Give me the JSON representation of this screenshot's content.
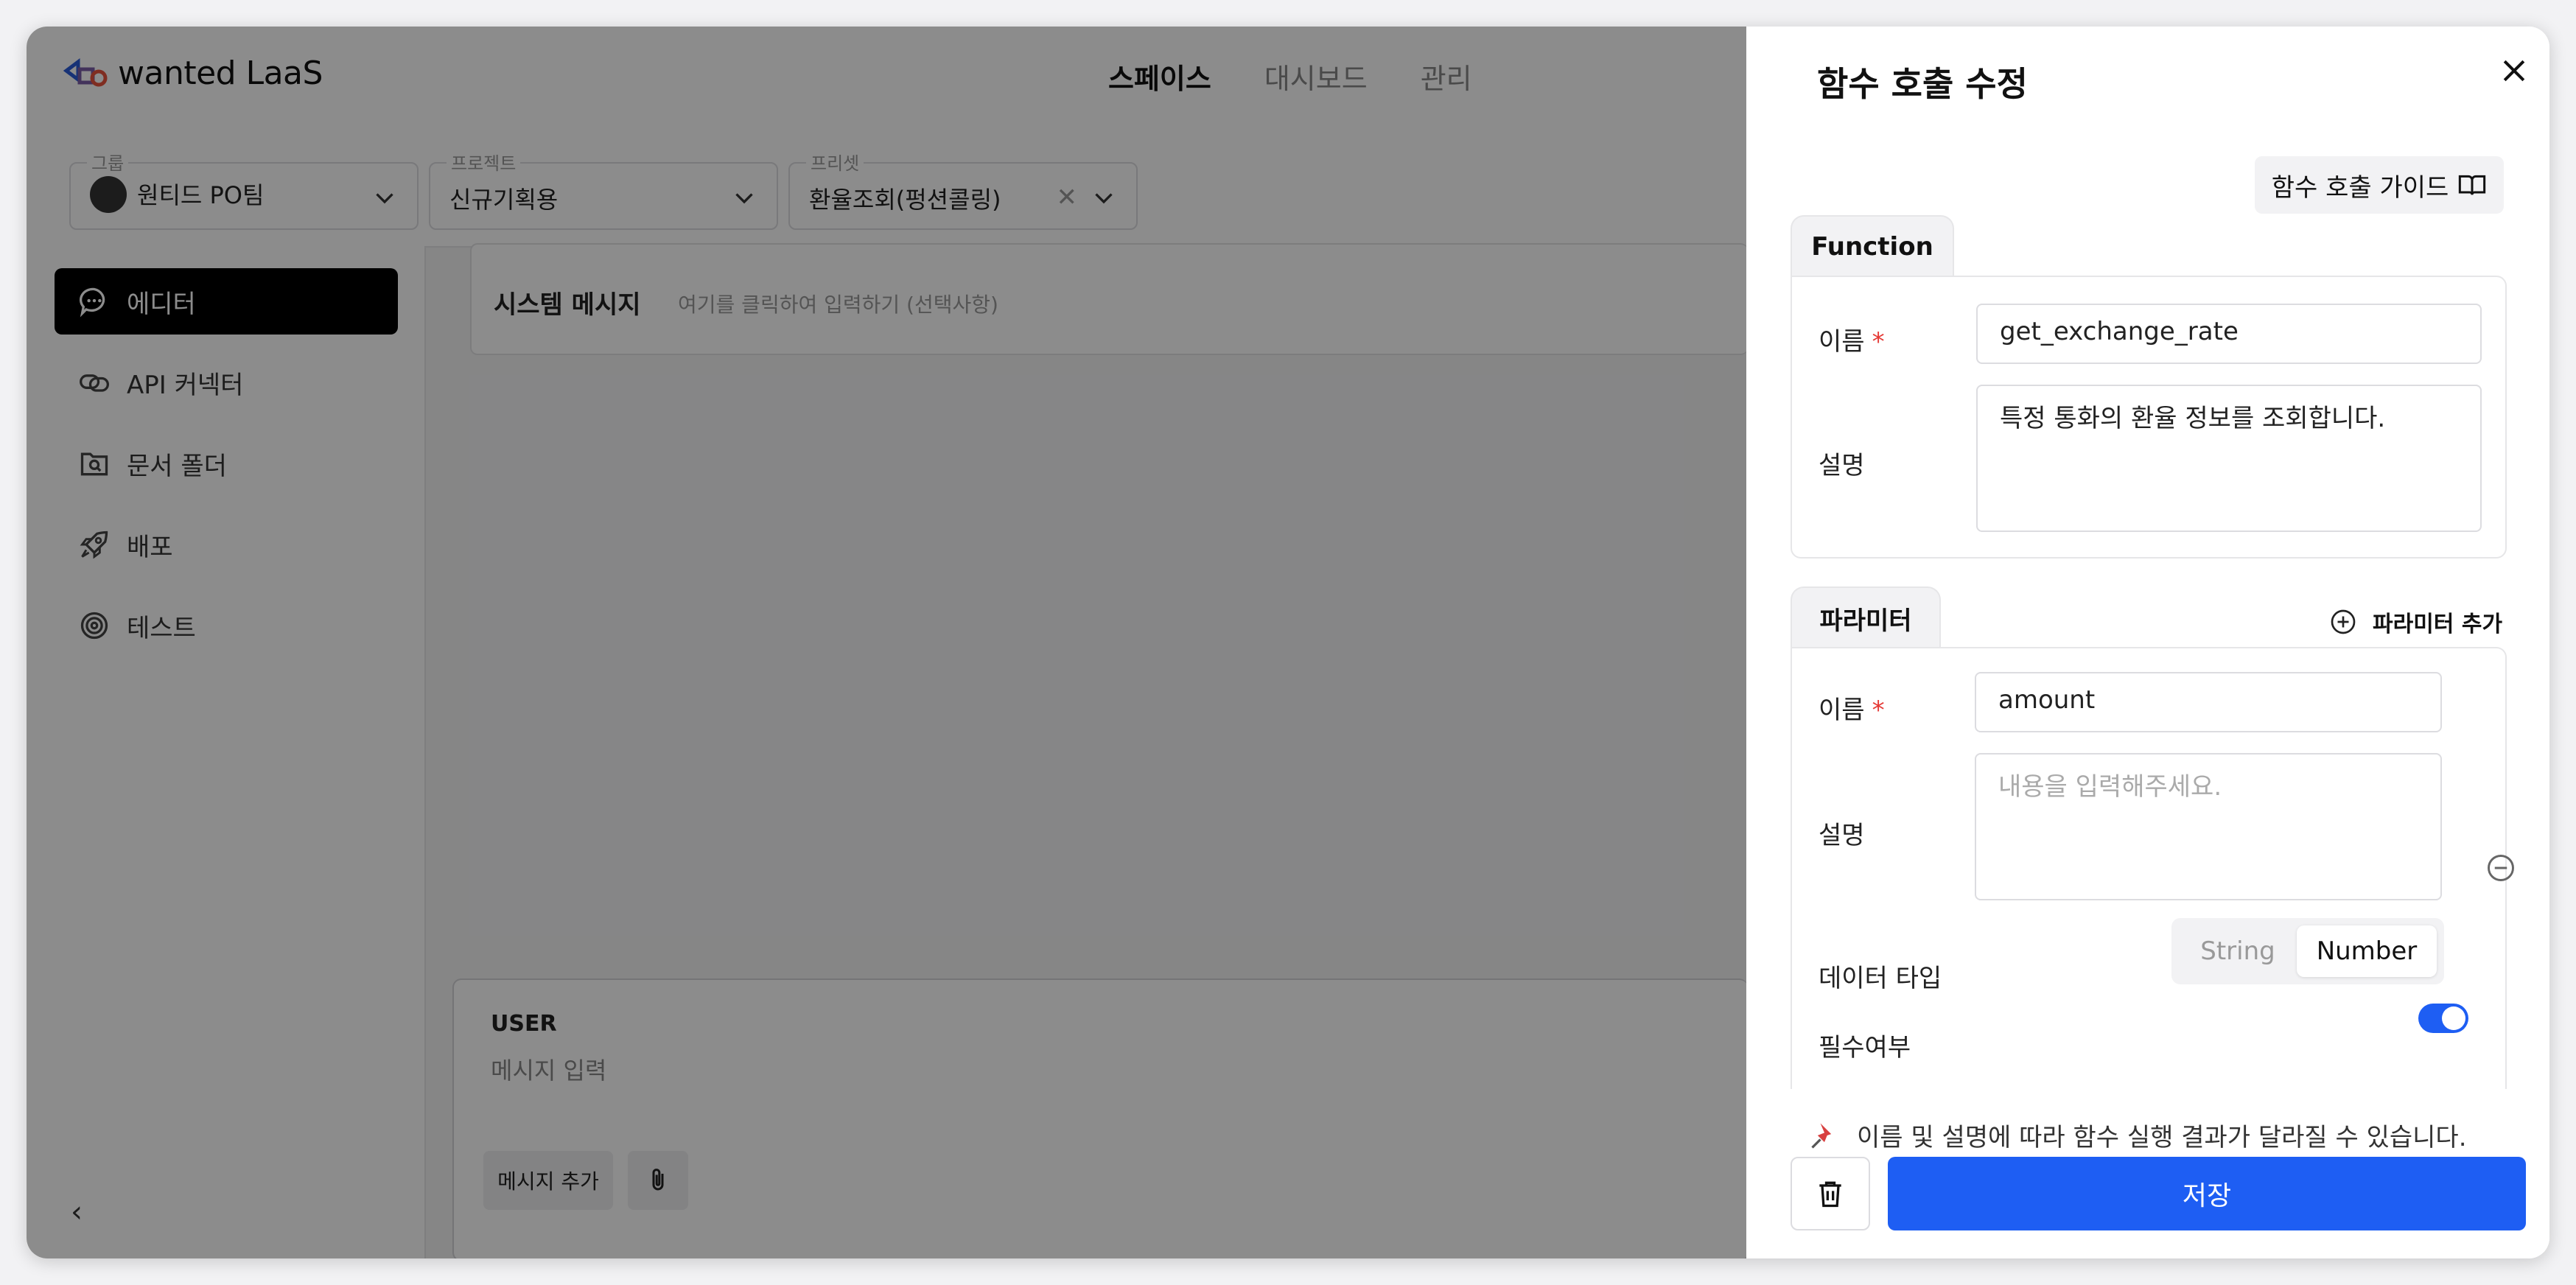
{
  "app": {
    "logo_text": "wanted LaaS",
    "nav": [
      "스페이스",
      "대시보드",
      "관리"
    ],
    "filters": {
      "group": {
        "label": "그룹",
        "value": "원티드 PO팀"
      },
      "project": {
        "label": "프로젝트",
        "value": "신규기획용"
      },
      "preset": {
        "label": "프리셋",
        "value": "환율조회(펑션콜링)"
      }
    },
    "sidebar": [
      {
        "label": "에디터",
        "icon": "chat-bubble-icon"
      },
      {
        "label": "API 커넥터",
        "icon": "link-icon"
      },
      {
        "label": "문서 폴더",
        "icon": "folder-search-icon"
      },
      {
        "label": "배포",
        "icon": "rocket-icon"
      },
      {
        "label": "테스트",
        "icon": "target-icon"
      }
    ],
    "system_message": {
      "title": "시스템 메시지",
      "placeholder": "여기를 클릭하여 입력하기 (선택사항)"
    },
    "user_box": {
      "role": "USER",
      "placeholder": "메시지 입력",
      "add_label": "메시지 추가"
    }
  },
  "panel": {
    "title": "함수 호출 수정",
    "guide_label": "함수 호출 가이드",
    "function_tab": "Function",
    "function": {
      "name_label": "이름",
      "name_value": "get_exchange_rate",
      "desc_label": "설명",
      "desc_value": "특정 통화의 환율 정보를 조회합니다."
    },
    "params_tab": "파라미터",
    "add_param_label": "파라미터 추가",
    "param": {
      "name_label": "이름",
      "name_value": "amount",
      "desc_label": "설명",
      "desc_placeholder": "내용을 입력해주세요.",
      "type_label": "데이터 타입",
      "type_options": [
        "String",
        "Number"
      ],
      "type_selected": "Number",
      "required_label": "필수여부",
      "required_on": true
    },
    "note": "이름 및 설명에 따라 함수 실행 결과가 달라질 수 있습니다.",
    "save_label": "저장",
    "colors": {
      "accent": "#1e5ef3",
      "required": "#e53935"
    }
  }
}
